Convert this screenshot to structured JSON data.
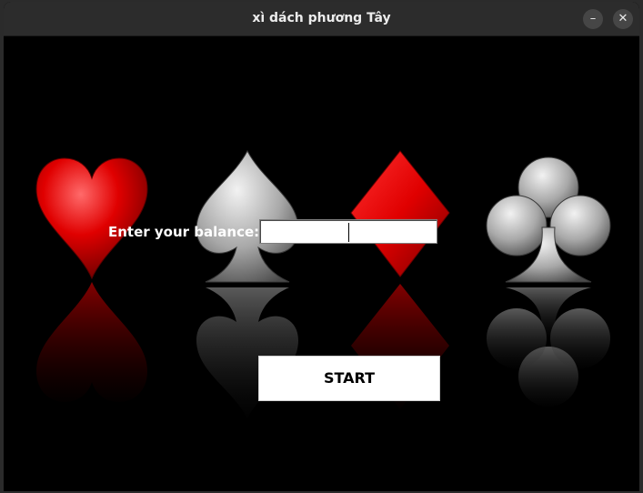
{
  "window": {
    "title": "xì dách phương Tây",
    "minimize_glyph": "–",
    "close_glyph": "✕"
  },
  "background": {
    "suits": [
      "heart",
      "spade",
      "diamond",
      "club"
    ]
  },
  "form": {
    "balance_label": "Enter your balance:",
    "balance_value": "",
    "start_label": "START"
  },
  "colors": {
    "background": "#000000",
    "heart": "#d40000",
    "diamond": "#e00000",
    "spade": "#b5b5b5",
    "club": "#c8c8c8",
    "button_bg": "#ffffff"
  }
}
